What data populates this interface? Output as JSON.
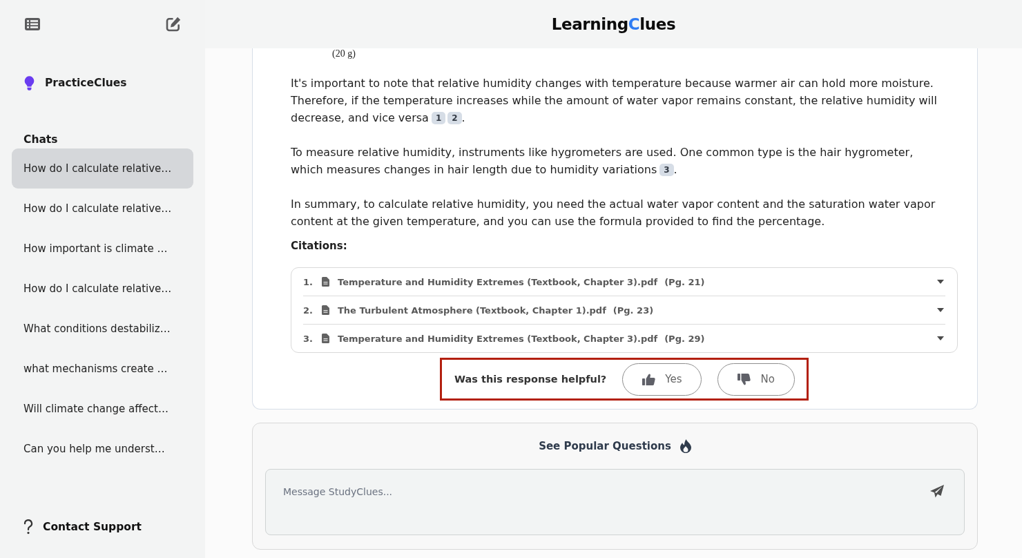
{
  "header": {
    "logo": [
      {
        "text": "Learning",
        "accent": false
      },
      {
        "text": "C",
        "accent": true
      },
      {
        "text": "lues",
        "accent": false
      }
    ]
  },
  "sidebar": {
    "brand": "PracticeClues",
    "chats_heading": "Chats",
    "chats": [
      {
        "title": "How do I calculate relative…",
        "selected": true
      },
      {
        "title": "How do I calculate relative…",
        "selected": false
      },
      {
        "title": "How important is climate …",
        "selected": false
      },
      {
        "title": "How do I calculate relative…",
        "selected": false
      },
      {
        "title": "What conditions destabiliz…",
        "selected": false
      },
      {
        "title": "what mechanisms create …",
        "selected": false
      },
      {
        "title": "Will climate change affect…",
        "selected": false
      },
      {
        "title": "Can you help me underst…",
        "selected": false
      }
    ],
    "support": "Contact Support"
  },
  "answer": {
    "formula_fragment": "(20 g)",
    "paragraphs": [
      {
        "text": "It's important to note that relative humidity changes with temperature because warmer air can hold more moisture. Therefore, if the temperature increases while the amount of water vapor remains constant, the relative humidity will decrease, and vice versa",
        "citations": [
          "1",
          "2"
        ],
        "end": "."
      },
      {
        "text": "To measure relative humidity, instruments like hygrometers are used. One common type is the hair hygrometer, which measures changes in hair length due to humidity variations",
        "citations": [
          "3"
        ],
        "end": "."
      },
      {
        "text": "In summary, to calculate relative humidity, you need the actual water vapor content and the saturation water vapor content at the given temperature, and you can use the formula provided to find the percentage."
      }
    ],
    "citations_heading": "Citations:",
    "citations": [
      {
        "number": "1.",
        "title": "Temperature and Humidity Extremes (Textbook, Chapter 3).pdf",
        "page": "(Pg. 21)"
      },
      {
        "number": "2.",
        "title": "The Turbulent Atmosphere (Textbook, Chapter 1).pdf",
        "page": "(Pg. 23)"
      },
      {
        "number": "3.",
        "title": "Temperature and Humidity Extremes (Textbook, Chapter 3).pdf",
        "page": "(Pg. 29)"
      }
    ]
  },
  "feedback": {
    "question": "Was this response helpful?",
    "highlighted": true,
    "buttons": [
      {
        "kind": "up",
        "label": "Yes"
      },
      {
        "kind": "down",
        "label": "No"
      }
    ]
  },
  "composer": {
    "popular_link": "See Popular Questions",
    "placeholder": "Message StudyClues..."
  }
}
